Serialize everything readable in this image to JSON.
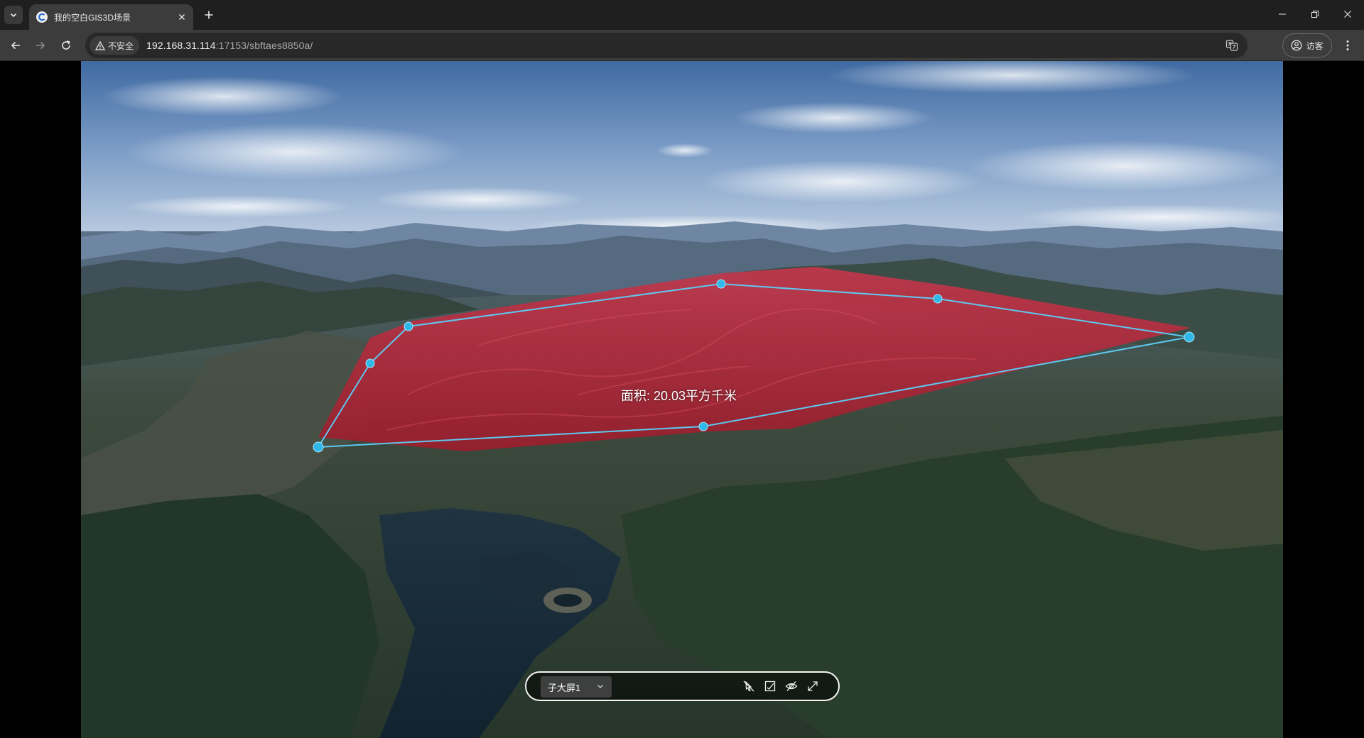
{
  "browser": {
    "tab": {
      "title": "我的空白GIS3D场景"
    },
    "address": {
      "security_label": "不安全",
      "url_host": "192.168.31.114",
      "url_rest": ":17153/sbftaes8850a/"
    },
    "profile_label": "访客"
  },
  "scene": {
    "area_measure_label": "面积: 20.03平方千米",
    "measure_polygon_color": "#c0283c",
    "measure_outline_color": "#5ec8f0"
  },
  "bottom_bar": {
    "screen_select_value": "子大屏1",
    "icons": [
      "no-pick-icon",
      "checkbox-square-icon",
      "eye-slash-icon",
      "expand-icon"
    ]
  }
}
